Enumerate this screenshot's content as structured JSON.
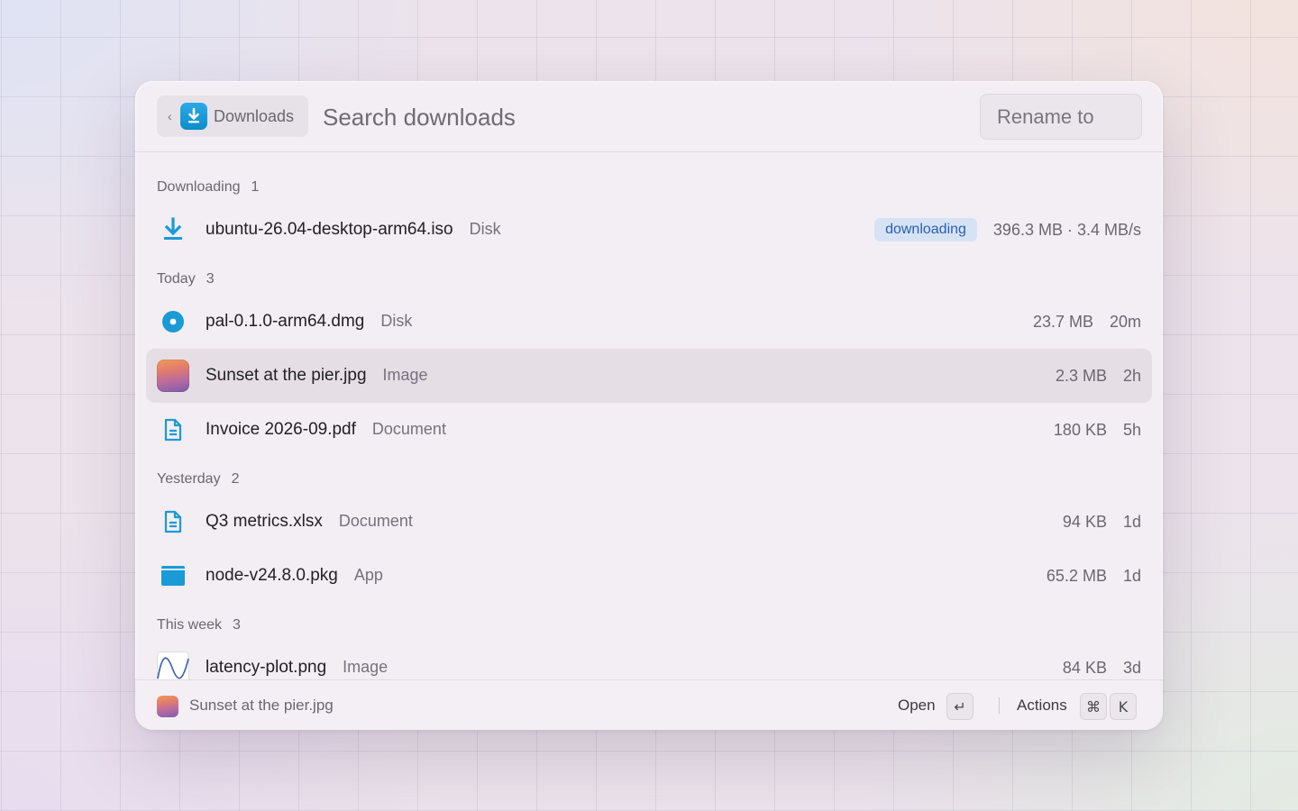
{
  "header": {
    "crumb_chevron": "‹",
    "crumb_label": "Downloads",
    "search_placeholder": "Search downloads",
    "rename_placeholder": "Rename to"
  },
  "sections": [
    {
      "title": "Downloading",
      "count": "1"
    },
    {
      "title": "Today",
      "count": "3"
    },
    {
      "title": "Yesterday",
      "count": "2"
    },
    {
      "title": "This week",
      "count": "3"
    }
  ],
  "items": [
    {
      "name": "ubuntu-26.04-desktop-arm64.iso",
      "kind": "Disk",
      "badge": "downloading",
      "size": "396.3 MB · 3.4 MB/s",
      "age": "",
      "icon": "download-icon"
    },
    {
      "name": "pal-0.1.0-arm64.dmg",
      "kind": "Disk",
      "size": "23.7 MB",
      "age": "20m",
      "icon": "disk-icon"
    },
    {
      "name": "Sunset at the pier.jpg",
      "kind": "Image",
      "size": "2.3 MB",
      "age": "2h",
      "icon": "image-thumbnail",
      "selected": true
    },
    {
      "name": "Invoice 2026-09.pdf",
      "kind": "Document",
      "size": "180 KB",
      "age": "5h",
      "icon": "document-icon"
    },
    {
      "name": "Q3 metrics.xlsx",
      "kind": "Document",
      "size": "94 KB",
      "age": "1d",
      "icon": "document-icon"
    },
    {
      "name": "node-v24.8.0.pkg",
      "kind": "App",
      "size": "65.2 MB",
      "age": "1d",
      "icon": "app-window-icon"
    },
    {
      "name": "latency-plot.png",
      "kind": "Image",
      "size": "84 KB",
      "age": "3d",
      "icon": "plot-thumbnail"
    }
  ],
  "footer": {
    "selected_name": "Sunset at the pier.jpg",
    "open_label": "Open",
    "open_key": "↵",
    "actions_label": "Actions",
    "actions_key_1": "⌘",
    "actions_key_2": "K"
  },
  "colors": {
    "accent": "#1a9ad6",
    "badge_bg": "#d6e3f5",
    "badge_text": "#2a5fb0"
  }
}
